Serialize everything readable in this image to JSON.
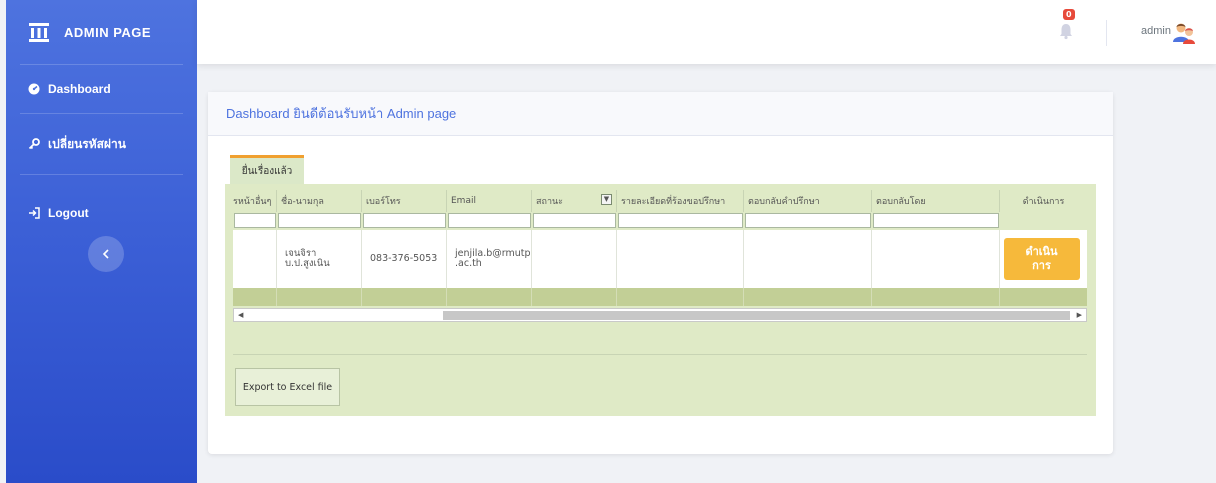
{
  "sidebar": {
    "brand": "ADMIN PAGE",
    "items": [
      {
        "label": "Dashboard",
        "icon": "dashboard-icon"
      },
      {
        "label": "เปลี่ยนรหัสผ่าน",
        "icon": "key-icon"
      },
      {
        "label": "Logout",
        "icon": "logout-icon"
      }
    ]
  },
  "topbar": {
    "notification_count": "0",
    "username": "admin"
  },
  "card": {
    "title": "Dashboard ยินดีต้อนรับหน้า Admin page",
    "tab_label": "ยื่นเรื่องแล้ว"
  },
  "table": {
    "columns": [
      "รหน้าอื่นๆ",
      "ชื่อ-นามกุล",
      "เบอร์โทร",
      "Email",
      "สถานะ",
      "รายละเอียดที่ร้องขอปรึกษา",
      "ตอบกลับคำปรึกษา",
      "ตอบกลับโดย",
      "ดำเนินการ"
    ],
    "row": {
      "col0": "",
      "name_line1": "เจนจิรา",
      "name_line2": "บ.ป.สูงเนิน",
      "phone": "083-376-5053",
      "email_line1": "jenjila.b@rmutp",
      "email_line2": ".ac.th",
      "status": "",
      "details": "",
      "reply": "",
      "reply_by": "",
      "action_line1": "ดำเนิน",
      "action_line2": "การ"
    }
  },
  "export_label": "Export to Excel file",
  "colors": {
    "sidebar_accent": "#4e73df",
    "action_button": "#f6b93b",
    "panel_bg": "#dfeac6"
  }
}
